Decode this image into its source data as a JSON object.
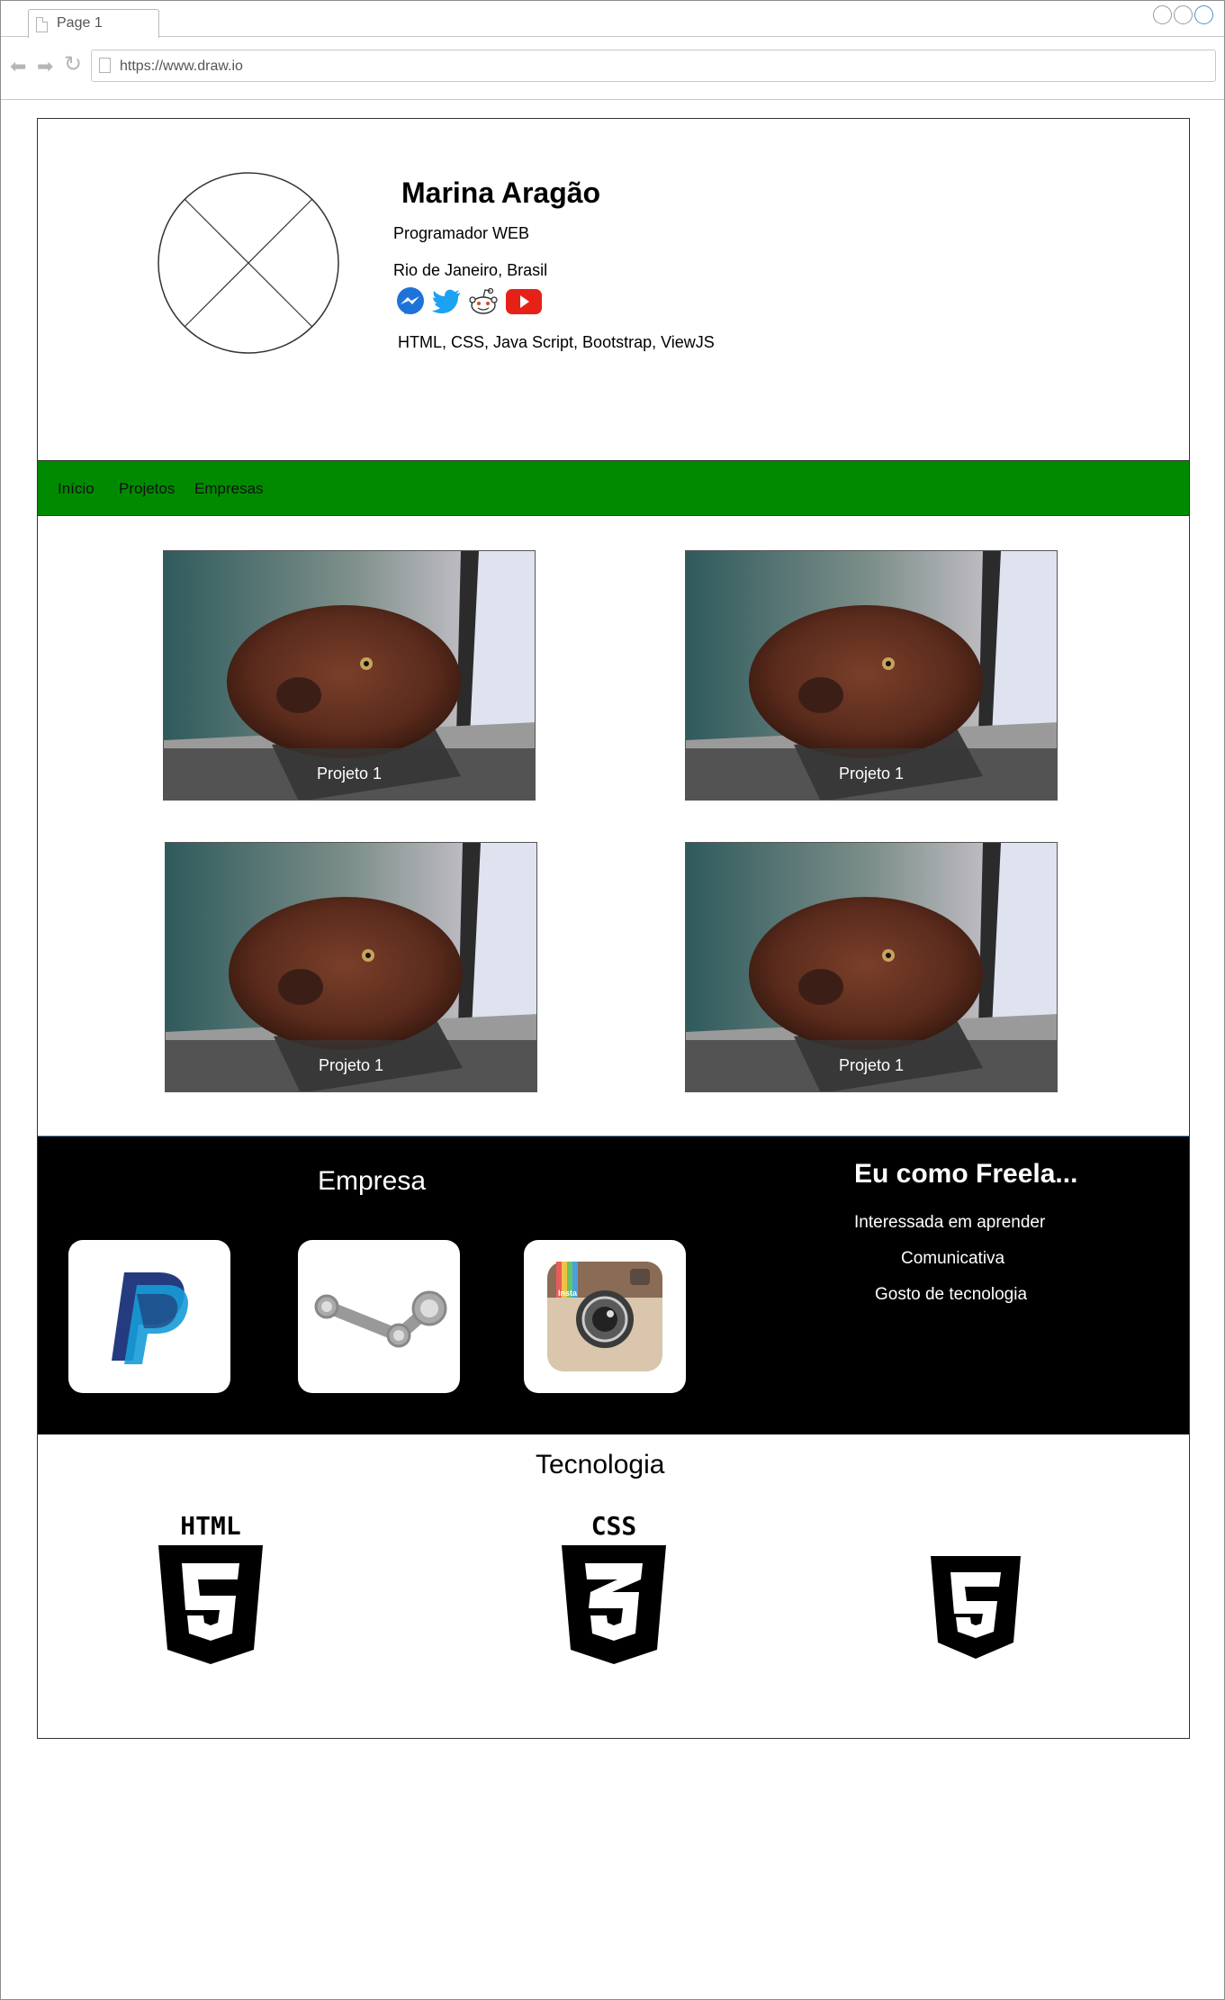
{
  "browser": {
    "tab_label": "Page 1",
    "url": "https://www.draw.io"
  },
  "profile": {
    "name": "Marina Aragão",
    "role": "Programador WEB",
    "location": "Rio de Janeiro, Brasil",
    "social_icons": [
      "messenger-icon",
      "twitter-icon",
      "reddit-icon",
      "youtube-icon"
    ],
    "skills": "HTML, CSS, Java Script, Bootstrap, ViewJS"
  },
  "navbar": {
    "items": [
      "Início",
      "Projetos",
      "Empresas"
    ],
    "color": "#008a00"
  },
  "projects": [
    {
      "caption": "Projeto 1"
    },
    {
      "caption": "Projeto 1"
    },
    {
      "caption": "Projeto 1"
    },
    {
      "caption": "Projeto 1"
    }
  ],
  "empresa": {
    "title": "Empresa",
    "companies": [
      "paypal-icon",
      "steam-icon",
      "instagram-icon"
    ],
    "instagram_badge": "Insta"
  },
  "freela": {
    "title": "Eu como Freela...",
    "items": [
      "Interessada em aprender",
      "Comunicativa",
      "Gosto de tecnologia"
    ]
  },
  "tecnologia": {
    "title": "Tecnologia",
    "icons": [
      "html5-icon",
      "css3-icon",
      "html5-shield-icon"
    ],
    "html_label": "HTML",
    "css_label": "CSS"
  }
}
